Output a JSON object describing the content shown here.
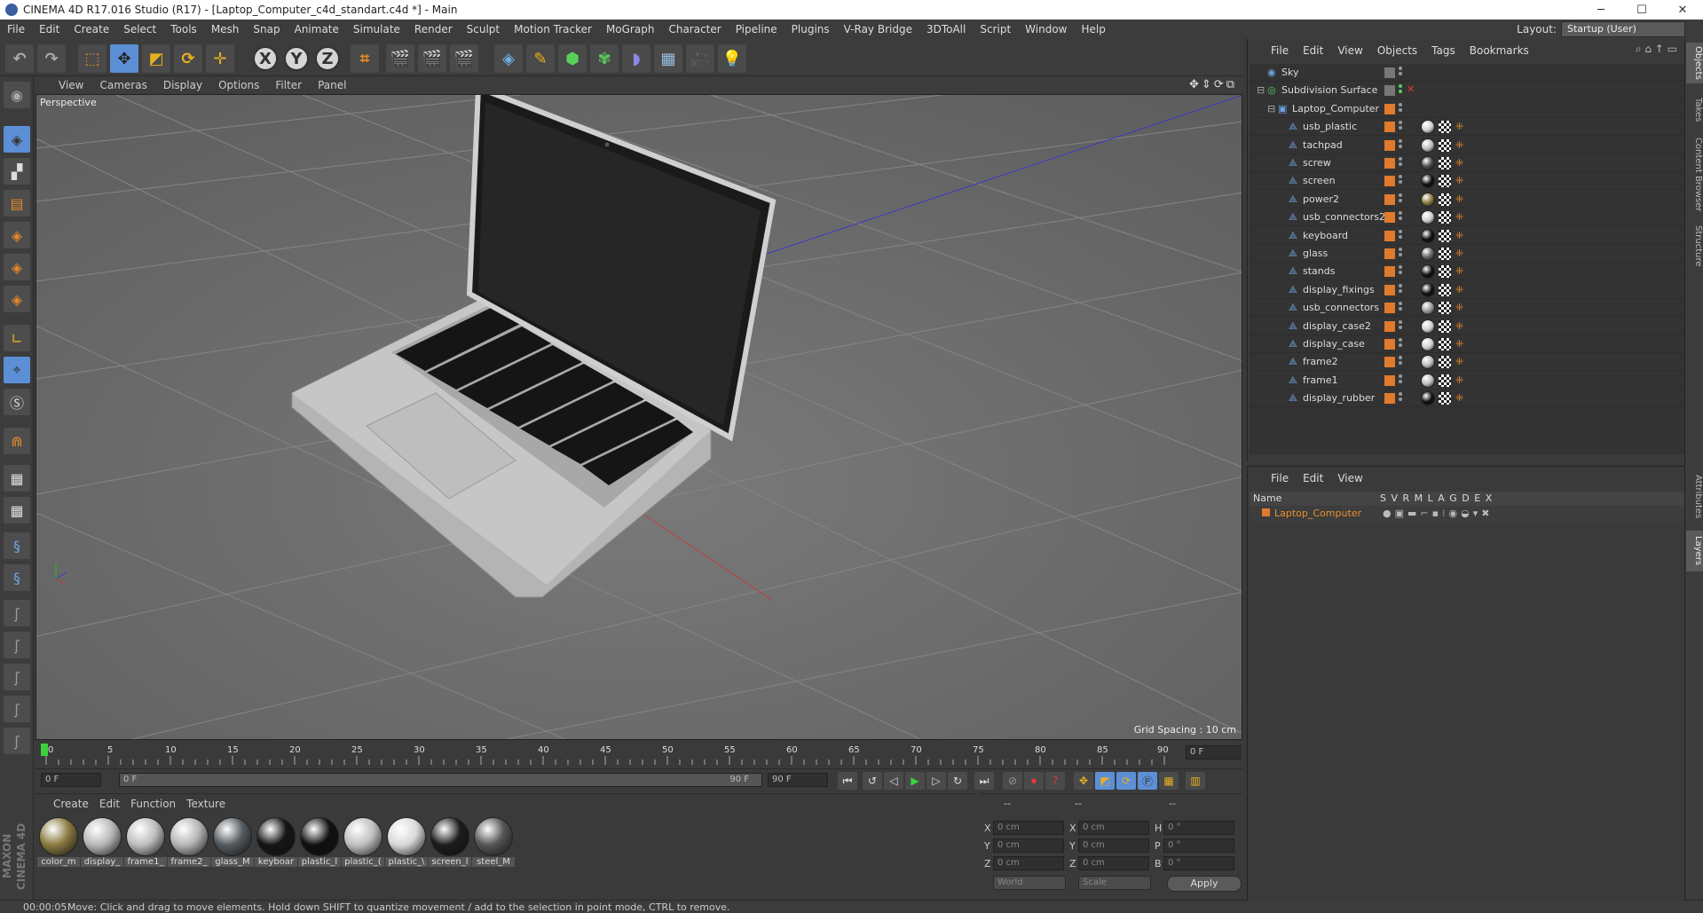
{
  "window": {
    "title": "CINEMA 4D R17.016 Studio (R17) - [Laptop_Computer_c4d_standart.c4d *] - Main",
    "minimize": "─",
    "maximize": "☐",
    "close": "✕"
  },
  "menu": [
    "File",
    "Edit",
    "Create",
    "Select",
    "Tools",
    "Mesh",
    "Snap",
    "Animate",
    "Simulate",
    "Render",
    "Sculpt",
    "Motion Tracker",
    "MoGraph",
    "Character",
    "Pipeline",
    "Plugins",
    "V-Ray Bridge",
    "3DToAll",
    "Script",
    "Window",
    "Help"
  ],
  "layout": {
    "label": "Layout:",
    "value": "Startup (User)"
  },
  "toolbar": {
    "x": "X",
    "y": "Y",
    "z": "Z"
  },
  "viewport": {
    "menu": [
      "View",
      "Cameras",
      "Display",
      "Options",
      "Filter",
      "Panel"
    ],
    "label": "Perspective",
    "grid_spacing": "Grid Spacing : 10 cm",
    "icons": "✥⇕⟳⧉"
  },
  "timeline": {
    "ticks": [
      "0",
      "5",
      "10",
      "15",
      "20",
      "25",
      "30",
      "35",
      "40",
      "45",
      "50",
      "55",
      "60",
      "65",
      "70",
      "75",
      "80",
      "85",
      "90"
    ],
    "end_field": "0 F",
    "start": "0 F",
    "slider_start": "0 F",
    "slider_end": "90 F",
    "end": "90 F"
  },
  "materials": {
    "menu": [
      "Create",
      "Edit",
      "Function",
      "Texture"
    ],
    "items": [
      {
        "label": "color_m",
        "color": "#8a7a40"
      },
      {
        "label": "display_",
        "color": "#b8b8b8"
      },
      {
        "label": "frame1_",
        "color": "#bdbdbd"
      },
      {
        "label": "frame2_",
        "color": "#b5b5b5"
      },
      {
        "label": "glass_M",
        "color": "#555a5e"
      },
      {
        "label": "keyboar",
        "color": "#151515"
      },
      {
        "label": "plastic_l",
        "color": "#101010"
      },
      {
        "label": "plastic_(",
        "color": "#c0c0c0"
      },
      {
        "label": "plastic_\\",
        "color": "#d8d8d8"
      },
      {
        "label": "screen_l",
        "color": "#1c1c1c"
      },
      {
        "label": "steel_M",
        "color": "#555"
      }
    ]
  },
  "coords": {
    "head1": "--",
    "head2": "--",
    "head3": "--",
    "x": "X",
    "y": "Y",
    "z": "Z",
    "h": "H",
    "p": "P",
    "b": "B",
    "val_cm": "0 cm",
    "val_deg": "0 °",
    "world": "World",
    "scale": "Scale",
    "apply": "Apply"
  },
  "brand": "MAXON CINEMA 4D",
  "status": {
    "time": "00:00:05",
    "message": "Move: Click and drag to move elements. Hold down SHIFT to quantize movement / add to the selection in point mode, CTRL to remove."
  },
  "objects": {
    "menu": [
      "File",
      "Edit",
      "View",
      "Objects",
      "Tags",
      "Bookmarks"
    ],
    "rows": [
      {
        "name": "Sky",
        "level": 0,
        "ball": ""
      },
      {
        "name": "Subdivision Surface",
        "level": 0,
        "ball": ""
      },
      {
        "name": "Laptop_Computer",
        "level": 1,
        "ball": ""
      },
      {
        "name": "usb_plastic",
        "level": 2,
        "ball": "#cfcfcf"
      },
      {
        "name": "tachpad",
        "level": 2,
        "ball": "#bdbdbd"
      },
      {
        "name": "screw",
        "level": 2,
        "ball": "#4a4a4a"
      },
      {
        "name": "screen",
        "level": 2,
        "ball": "#111"
      },
      {
        "name": "power2",
        "level": 2,
        "ball": "#8a7a40"
      },
      {
        "name": "usb_connectors2",
        "level": 2,
        "ball": "#cfcfcf"
      },
      {
        "name": "keyboard",
        "level": 2,
        "ball": "#111"
      },
      {
        "name": "glass",
        "level": 2,
        "ball": "#666"
      },
      {
        "name": "stands",
        "level": 2,
        "ball": "#111"
      },
      {
        "name": "display_fixings",
        "level": 2,
        "ball": "#111"
      },
      {
        "name": "usb_connectors",
        "level": 2,
        "ball": "#999"
      },
      {
        "name": "display_case2",
        "level": 2,
        "ball": "#cfcfcf"
      },
      {
        "name": "display_case",
        "level": 2,
        "ball": "#cfcfcf"
      },
      {
        "name": "frame2",
        "level": 2,
        "ball": "#bdbdbd"
      },
      {
        "name": "frame1",
        "level": 2,
        "ball": "#bdbdbd"
      },
      {
        "name": "display_rubber",
        "level": 2,
        "ball": "#111"
      }
    ]
  },
  "layers": {
    "menu": [
      "File",
      "Edit",
      "View"
    ],
    "head_name": "Name",
    "head_cols": "S V R M L A G D E X",
    "row": "Laptop_Computer"
  },
  "right_tabs": [
    "Objects",
    "Takes",
    "Content Browser",
    "Structure",
    "Attributes",
    "Layers"
  ]
}
